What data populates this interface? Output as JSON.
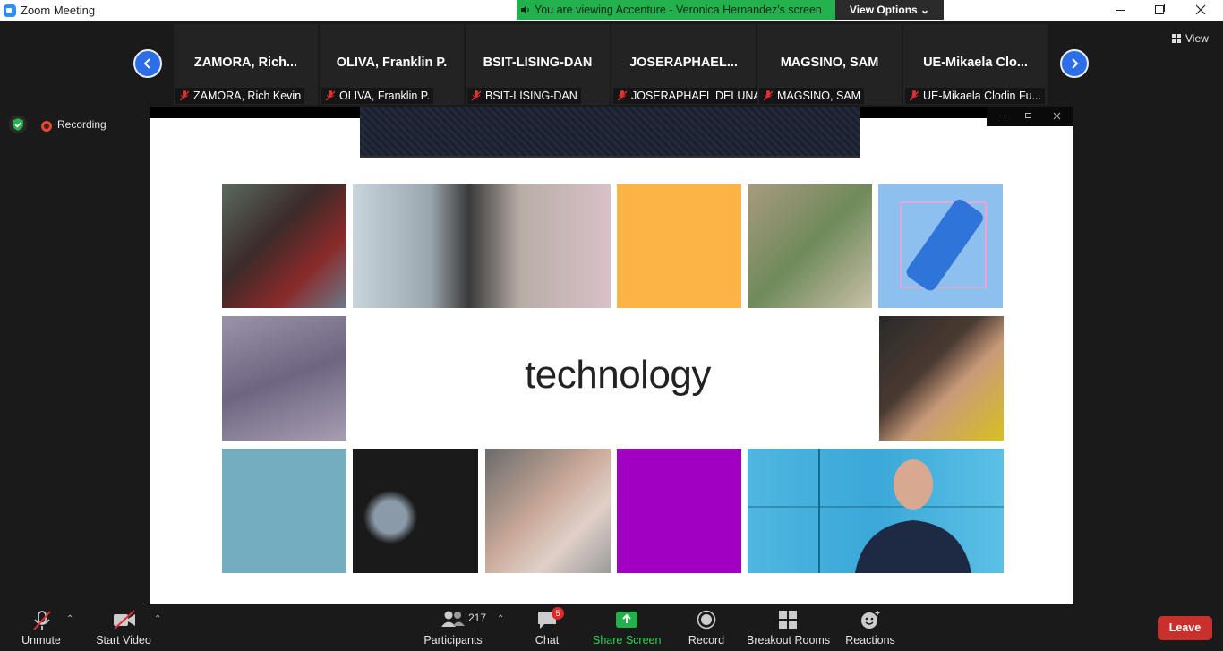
{
  "window": {
    "title": "Zoom Meeting"
  },
  "banner": {
    "text": "You are viewing Accenture - Veronica Hernandez's screen",
    "view_options": "View Options ⌄"
  },
  "gallery": {
    "view_label": "View",
    "tiles": [
      {
        "name": "ZAMORA,  Rich...",
        "label": "ZAMORA, Rich Kevin"
      },
      {
        "name": "OLIVA, Franklin P.",
        "label": "OLIVA, Franklin P."
      },
      {
        "name": "BSIT-LISING-DAN",
        "label": "BSIT-LISING-DAN"
      },
      {
        "name": "JOSERAPHAEL...",
        "label": "JOSERAPHAEL DELUNA"
      },
      {
        "name": "MAGSINO, SAM",
        "label": "MAGSINO, SAM"
      },
      {
        "name": "UE-Mikaela  Clo...",
        "label": "UE-Mikaela Clodin Fu..."
      }
    ]
  },
  "status": {
    "recording": "Recording"
  },
  "slide": {
    "word": "technology",
    "colors": {
      "orange": "#fdb446",
      "purple": "#a100c2",
      "teal": "#75adc0",
      "lightblue": "#8ec0ef"
    }
  },
  "toolbar": {
    "unmute": "Unmute",
    "start_video": "Start Video",
    "participants": "Participants",
    "participants_count": "217",
    "chat": "Chat",
    "chat_badge": "5",
    "share_screen": "Share Screen",
    "record": "Record",
    "breakout": "Breakout Rooms",
    "reactions": "Reactions",
    "leave": "Leave"
  }
}
